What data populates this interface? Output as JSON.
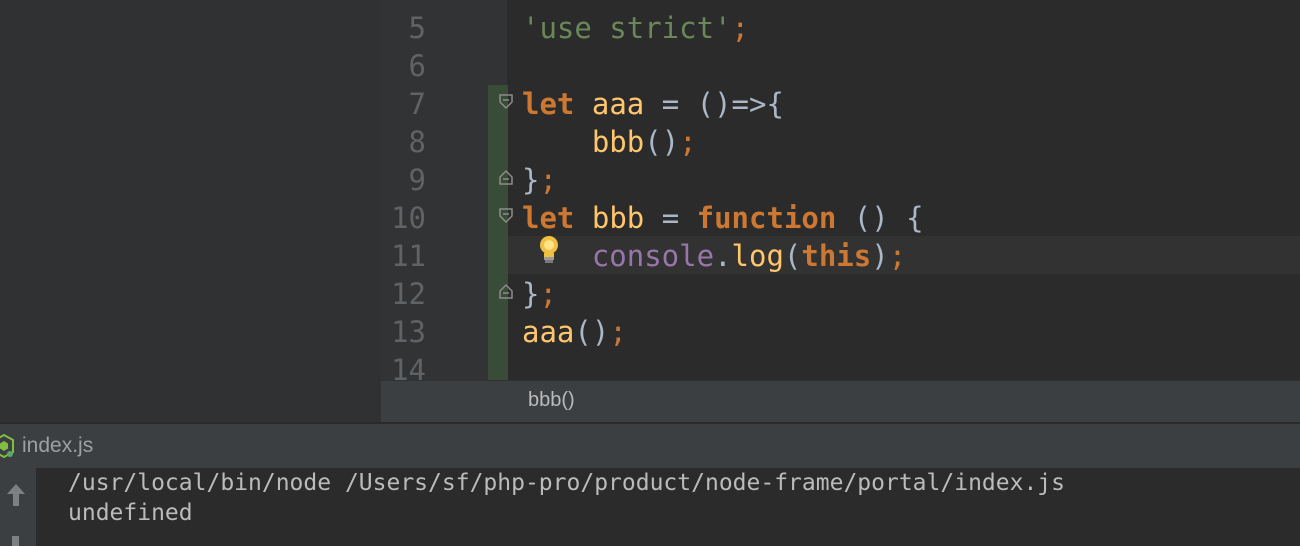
{
  "editor": {
    "lines": [
      {
        "number": "5",
        "tokens": [
          {
            "t": "'use strict'",
            "c": "str"
          },
          {
            "t": ";",
            "c": "pun"
          }
        ]
      },
      {
        "number": "6",
        "tokens": []
      },
      {
        "number": "7",
        "tokens": [
          {
            "t": "let",
            "c": "kw"
          },
          {
            "t": " ",
            "c": "op"
          },
          {
            "t": "aaa",
            "c": "fn"
          },
          {
            "t": " = ()=>{",
            "c": "op"
          }
        ]
      },
      {
        "number": "8",
        "tokens": [
          {
            "t": "    ",
            "c": "op"
          },
          {
            "t": "bbb",
            "c": "fn"
          },
          {
            "t": "()",
            "c": "op"
          },
          {
            "t": ";",
            "c": "pun"
          }
        ]
      },
      {
        "number": "9",
        "tokens": [
          {
            "t": "}",
            "c": "op"
          },
          {
            "t": ";",
            "c": "pun"
          }
        ]
      },
      {
        "number": "10",
        "tokens": [
          {
            "t": "let",
            "c": "kw"
          },
          {
            "t": " ",
            "c": "op"
          },
          {
            "t": "bbb",
            "c": "fn"
          },
          {
            "t": " = ",
            "c": "op"
          },
          {
            "t": "function",
            "c": "kw"
          },
          {
            "t": " () {",
            "c": "op"
          }
        ]
      },
      {
        "number": "11",
        "tokens": [
          {
            "t": "    ",
            "c": "op"
          },
          {
            "t": "console",
            "c": "obj"
          },
          {
            "t": ".",
            "c": "op"
          },
          {
            "t": "log",
            "c": "fn"
          },
          {
            "t": "(",
            "c": "op"
          },
          {
            "t": "this",
            "c": "kw"
          },
          {
            "t": ")",
            "c": "op"
          },
          {
            "t": ";",
            "c": "pun"
          }
        ]
      },
      {
        "number": "12",
        "tokens": [
          {
            "t": "}",
            "c": "op"
          },
          {
            "t": ";",
            "c": "pun"
          }
        ]
      },
      {
        "number": "13",
        "tokens": [
          {
            "t": "aaa",
            "c": "fn"
          },
          {
            "t": "()",
            "c": "op"
          },
          {
            "t": ";",
            "c": "pun"
          }
        ]
      },
      {
        "number": "14",
        "tokens": []
      }
    ]
  },
  "breadcrumb": {
    "label": "bbb()"
  },
  "run": {
    "tab_label": "index.js",
    "output": [
      "/usr/local/bin/node /Users/sf/php-pro/product/node-frame/portal/index.js",
      "undefined"
    ]
  },
  "colors": {
    "keyword": "#cc7832",
    "function": "#ffc66d",
    "string": "#6a8759",
    "object": "#9876aa",
    "default": "#a9b7c6",
    "change_marker": "#384c38"
  },
  "icons": {
    "fold_open": "fold-open-icon",
    "fold_close": "fold-close-icon",
    "intention": "lightbulb-icon",
    "node": "nodejs-icon",
    "scroll_up": "up-arrow-icon"
  }
}
